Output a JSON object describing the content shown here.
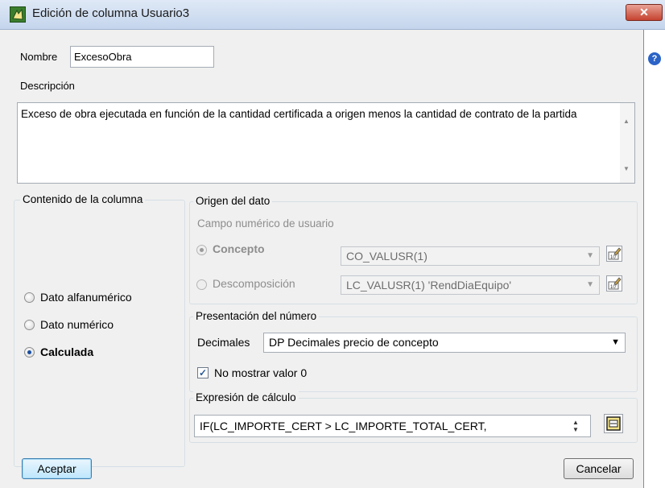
{
  "window": {
    "title": "Edición de columna Usuario3",
    "close_symbol": "✕"
  },
  "form": {
    "nombre_label": "Nombre",
    "nombre_value": "ExcesoObra",
    "descripcion_label": "Descripción",
    "descripcion_value": "Exceso de obra ejecutada en función de la cantidad certificada a origen menos la cantidad de contrato de la partida"
  },
  "contenido": {
    "label": "Contenido de la columna",
    "options": [
      {
        "label": "Dato alfanumérico",
        "checked": false
      },
      {
        "label": "Dato numérico",
        "checked": false
      },
      {
        "label": "Calculada",
        "checked": true
      }
    ]
  },
  "origen": {
    "label": "Origen del dato",
    "subtitle": "Campo numérico de usuario",
    "concepto_label": "Concepto",
    "concepto_value": "CO_VALUSR(1)",
    "descomposicion_label": "Descomposición",
    "descomposicion_value": "LC_VALUSR(1) 'RendDiaEquipo'"
  },
  "presentacion": {
    "label": "Presentación del número",
    "decimales_label": "Decimales",
    "decimales_value": "DP Decimales precio de concepto",
    "no_mostrar_label": "No mostrar valor 0",
    "no_mostrar_checked": true
  },
  "expresion": {
    "label": "Expresión de cálculo",
    "value": "IF(LC_IMPORTE_CERT > LC_IMPORTE_TOTAL_CERT,"
  },
  "buttons": {
    "aceptar": "Aceptar",
    "cancelar": "Cancelar"
  },
  "help_symbol": "?",
  "colors": {
    "accent": "#1a4d9e",
    "close": "#c5432f",
    "help": "#2b63c7"
  }
}
